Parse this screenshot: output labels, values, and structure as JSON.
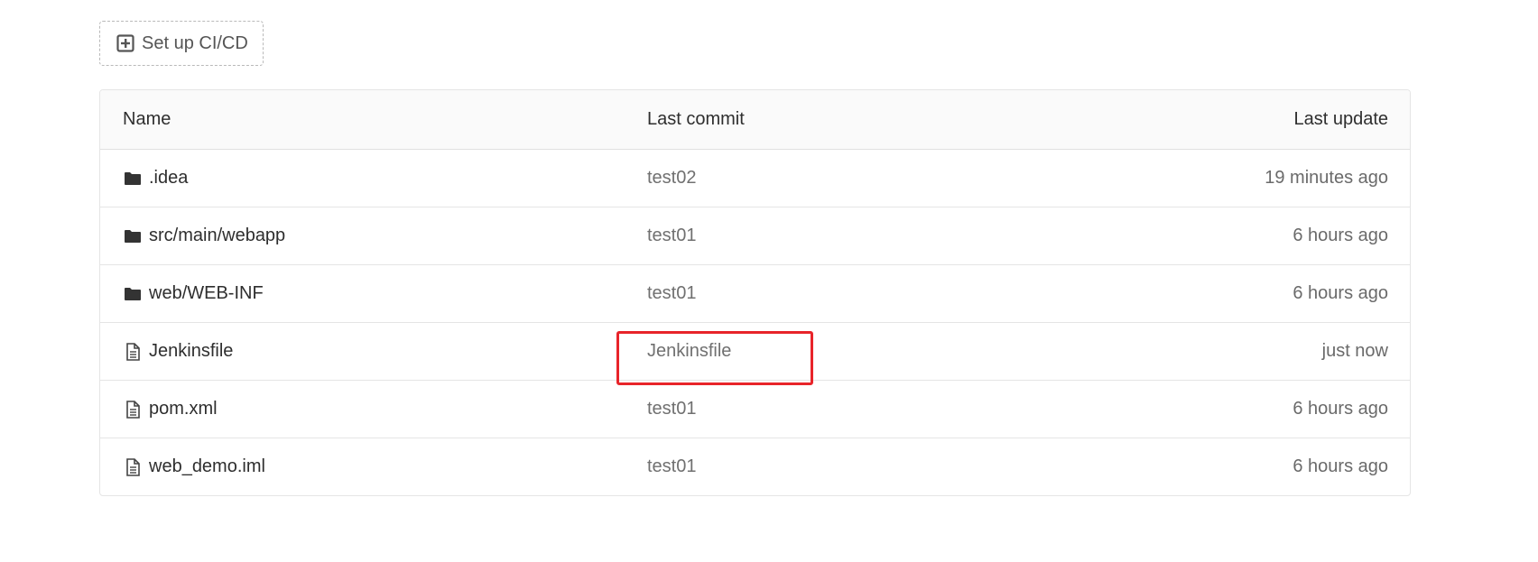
{
  "cicd_button": {
    "label": "Set up CI/CD",
    "icon": "plus-square-icon"
  },
  "table": {
    "headers": {
      "name": "Name",
      "last_commit": "Last commit",
      "last_update": "Last update"
    },
    "rows": [
      {
        "type": "folder",
        "icon": "folder-icon",
        "name": ".idea",
        "commit": "test02",
        "updated": "19 minutes ago"
      },
      {
        "type": "folder",
        "icon": "folder-icon",
        "name": "src/main/webapp",
        "commit": "test01",
        "updated": "6 hours ago"
      },
      {
        "type": "folder",
        "icon": "folder-icon",
        "name": "web/WEB-INF",
        "commit": "test01",
        "updated": "6 hours ago"
      },
      {
        "type": "file",
        "icon": "file-icon",
        "name": "Jenkinsfile",
        "commit": "Jenkinsfile",
        "updated": "just now"
      },
      {
        "type": "file",
        "icon": "file-icon",
        "name": "pom.xml",
        "commit": "test01",
        "updated": "6 hours ago"
      },
      {
        "type": "file",
        "icon": "file-icon",
        "name": "web_demo.iml",
        "commit": "test01",
        "updated": "6 hours ago"
      }
    ]
  },
  "colors": {
    "highlight_box": "#e8242a",
    "border": "#e5e5e5",
    "header_bg": "#fafafa"
  }
}
